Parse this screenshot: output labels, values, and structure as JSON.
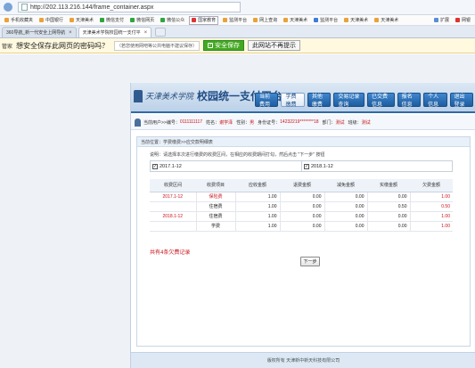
{
  "browser": {
    "address": "http://202.113.216.144/frame_container.aspx",
    "favorites": [
      "手机收藏夹",
      "中国银行",
      "天津美术",
      "微信支付",
      "微信网页",
      "微信公众",
      "国家教育",
      "监测平台",
      "网上查询",
      "天津美术",
      "监测平台",
      "天津美术",
      "天津美术"
    ],
    "favorites_right": [
      "扩展",
      "网银"
    ],
    "tabs": [
      {
        "label": "360导航_新一代安全上网导航",
        "active": false
      },
      {
        "label": "天津美术学院校园统一支付平",
        "active": true
      }
    ],
    "password_bar": {
      "mark": "管家",
      "message": "想安全保存此网页的密码吗？",
      "hint": "（若您使用网吧等公共电脑不建议保存）",
      "save_label": "安全保存",
      "never_label": "此网站不再提示"
    }
  },
  "page": {
    "school_name": "天津美术学院",
    "platform_title": "校园统一支付平台",
    "nav": [
      {
        "label": "当前费用",
        "active": false
      },
      {
        "label": "学费缴费",
        "active": true
      },
      {
        "label": "其他缴费",
        "active": false
      },
      {
        "label": "交易记录查询",
        "active": false
      },
      {
        "label": "已交费信息",
        "active": false
      },
      {
        "label": "报名信息",
        "active": false
      },
      {
        "label": "个人信息",
        "active": false
      },
      {
        "label": "退出登录",
        "active": false
      }
    ],
    "user_info": {
      "prefix": "当前用户>>编号：",
      "id": "0111111117",
      "name_label": "姓名：",
      "name": "谢学泽",
      "gender_label": "性别：",
      "gender": "男",
      "idcard_label": "身份证号：",
      "idcard": "14232219********18",
      "dept_label": "部门：",
      "dept": "测试",
      "class_label": "班级：",
      "class_name": "测试"
    },
    "breadcrumb": "当前位置：学费缴费>>应交款明细表",
    "instruction": "说明：请选择本次进行缴费的收费区间，在相应的收费期间打勾，然后点击 \"下一步\" 按钮",
    "periods": [
      {
        "label": "2017.1-12",
        "checked": true
      },
      {
        "label": "2018.1-12",
        "checked": true
      }
    ],
    "table": {
      "headers": [
        "收费区间",
        "收费项目",
        "应收金额",
        "退费金额",
        "减免金额",
        "实缴金额",
        "欠费金额"
      ],
      "rows": [
        {
          "period": "2017.1-12",
          "item": "保险费",
          "item_red": true,
          "due": "1.00",
          "refund": "0.00",
          "reduce": "0.00",
          "paid": "0.00",
          "owe": "1.00"
        },
        {
          "period": "",
          "item": "住宿费",
          "item_red": false,
          "due": "1.00",
          "refund": "0.00",
          "reduce": "0.00",
          "paid": "0.50",
          "owe": "0.50"
        },
        {
          "period": "2018.1-12",
          "item": "住宿费",
          "item_red": false,
          "due": "1.00",
          "refund": "0.00",
          "reduce": "0.00",
          "paid": "0.00",
          "owe": "1.00"
        },
        {
          "period": "",
          "item": "学费",
          "item_red": false,
          "due": "1.00",
          "refund": "0.00",
          "reduce": "0.00",
          "paid": "0.00",
          "owe": "1.00"
        }
      ]
    },
    "summary": "共有4条欠费记录",
    "next_button": "下一步",
    "footer": "版权所有 天津新中新天科技有限公司"
  },
  "colors": {
    "accent_blue": "#1f4d86",
    "nav_blue": "#2f6fb3",
    "highlight_red": "#c8121a",
    "save_green": "#43a823"
  }
}
